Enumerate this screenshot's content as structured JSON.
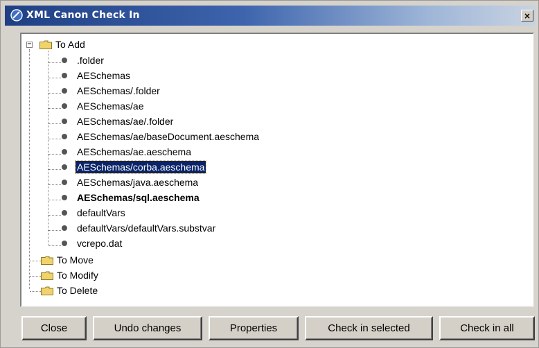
{
  "window": {
    "title": "XML Canon Check In",
    "close_label": "×"
  },
  "tree": {
    "groups": [
      {
        "label": "To Add",
        "expanded": true,
        "expander": "−",
        "children": [
          ".folder",
          "AESchemas",
          "AESchemas/.folder",
          "AESchemas/ae",
          "AESchemas/ae/.folder",
          "AESchemas/ae/baseDocument.aeschema",
          "AESchemas/ae.aeschema",
          "AESchemas/corba.aeschema",
          "AESchemas/java.aeschema",
          "AESchemas/sql.aeschema",
          "defaultVars",
          "defaultVars/defaultVars.substvar",
          "vcrepo.dat"
        ],
        "selected_child": "AESchemas/corba.aeschema",
        "bold_child": "AESchemas/sql.aeschema"
      },
      {
        "label": "To Move"
      },
      {
        "label": "To Modify"
      },
      {
        "label": "To Delete"
      }
    ]
  },
  "buttons": {
    "close": "Close",
    "undo": "Undo changes",
    "properties": "Properties",
    "check_in_selected": "Check in selected",
    "check_in_all": "Check in all"
  },
  "colors": {
    "title_bar_start": "#1f3f84",
    "selection": "#0a246a",
    "folder": "#f2d36b"
  }
}
